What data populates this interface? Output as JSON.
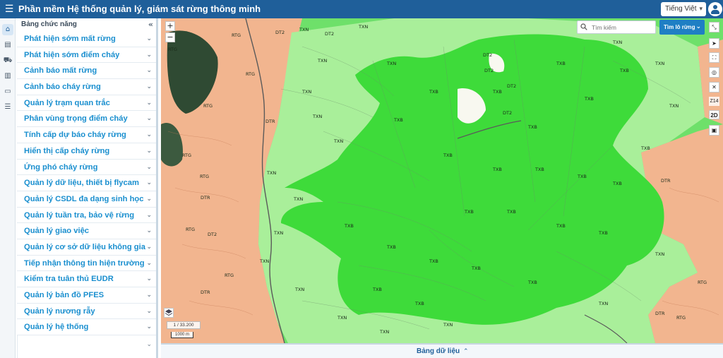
{
  "app": {
    "title": "Phần mềm Hệ thống quản lý, giám sát rừng thông minh",
    "language": "Tiếng Việt"
  },
  "colors": {
    "header": "#1f5f9a",
    "accent": "#1a8fcf",
    "forest_bright": "#3edb3a",
    "forest_mid": "#6ee06a",
    "forest_light": "#a9ef9a",
    "land_salmon": "#f2b58f",
    "dark_forest": "#2f4a33"
  },
  "rail_icons": [
    "home-icon",
    "layers-icon",
    "car-icon",
    "book-icon",
    "folder-icon",
    "sliders-icon"
  ],
  "sidebar": {
    "header": "Bảng chức năng",
    "items": [
      {
        "label": "Phát hiện sớm mất rừng"
      },
      {
        "label": "Phát hiện sớm điểm cháy"
      },
      {
        "label": "Cảnh báo mất rừng"
      },
      {
        "label": "Cảnh báo cháy rừng"
      },
      {
        "label": "Quản lý trạm quan trắc"
      },
      {
        "label": "Phân vùng trọng điểm cháy"
      },
      {
        "label": "Tính cấp dự báo cháy rừng"
      },
      {
        "label": "Hiển thị cấp cháy rừng"
      },
      {
        "label": "Ứng phó cháy rừng"
      },
      {
        "label": "Quản lý dữ liệu, thiết bị flycam"
      },
      {
        "label": "Quản lý CSDL đa dạng sinh học"
      },
      {
        "label": "Quản lý tuần tra, bảo vệ rừng"
      },
      {
        "label": "Quản lý giao việc"
      },
      {
        "label": "Quản lý cơ sở dữ liệu không gian"
      },
      {
        "label": "Tiếp nhận thông tin hiện trường"
      },
      {
        "label": "Kiểm tra tuân thủ EUDR"
      },
      {
        "label": "Quản lý bản đồ PFES"
      },
      {
        "label": "Quản lý nương rẫy"
      },
      {
        "label": "Quản lý hệ thống"
      }
    ]
  },
  "map": {
    "zoom_in": "+",
    "zoom_out": "−",
    "search_placeholder": "Tìm kiếm",
    "find_button": "Tìm lô rừng",
    "zoom_level": "Z14",
    "view_mode": "2D",
    "scale_ratio": "1 / 33.200",
    "scale_bar": "1000 m",
    "labels": {
      "txn": "TXN",
      "txb": "TXB",
      "rtg": "RTG",
      "dt2": "DT2",
      "dtr": "DTR"
    }
  },
  "data_panel": {
    "label": "Bảng dữ liệu"
  }
}
